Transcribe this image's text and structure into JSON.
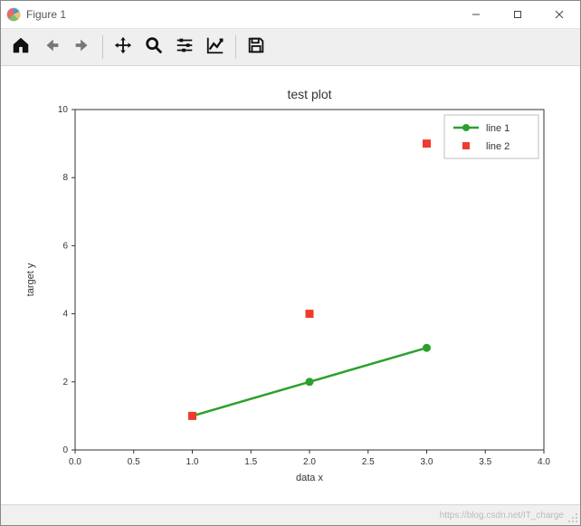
{
  "window": {
    "title": "Figure 1",
    "minimize_label": "Minimize",
    "maximize_label": "Maximize",
    "close_label": "Close"
  },
  "toolbar": {
    "home": "Home",
    "back": "Back",
    "forward": "Forward",
    "pan": "Pan",
    "zoom": "Zoom",
    "configure": "Configure subplots",
    "edit": "Edit axis",
    "save": "Save"
  },
  "status": {
    "watermark": "https://blog.csdn.net/IT_charge"
  },
  "chart_data": {
    "type": "mixed",
    "title": "test plot",
    "xlabel": "data x",
    "ylabel": "target y",
    "xlim": [
      0.0,
      4.0
    ],
    "ylim": [
      0,
      10
    ],
    "xticks": [
      0.0,
      0.5,
      1.0,
      1.5,
      2.0,
      2.5,
      3.0,
      3.5,
      4.0
    ],
    "yticks": [
      0,
      2,
      4,
      6,
      8,
      10
    ],
    "grid": false,
    "legend_position": "upper-right",
    "series": [
      {
        "name": "line 1",
        "type": "line",
        "marker": "circle",
        "color": "#2ca02c",
        "x": [
          1.0,
          2.0,
          3.0
        ],
        "y": [
          1,
          2,
          3
        ]
      },
      {
        "name": "line 2",
        "type": "scatter",
        "marker": "square",
        "color": "#ef3b2c",
        "x": [
          1.0,
          2.0,
          3.0
        ],
        "y": [
          1,
          4,
          9
        ]
      }
    ]
  }
}
